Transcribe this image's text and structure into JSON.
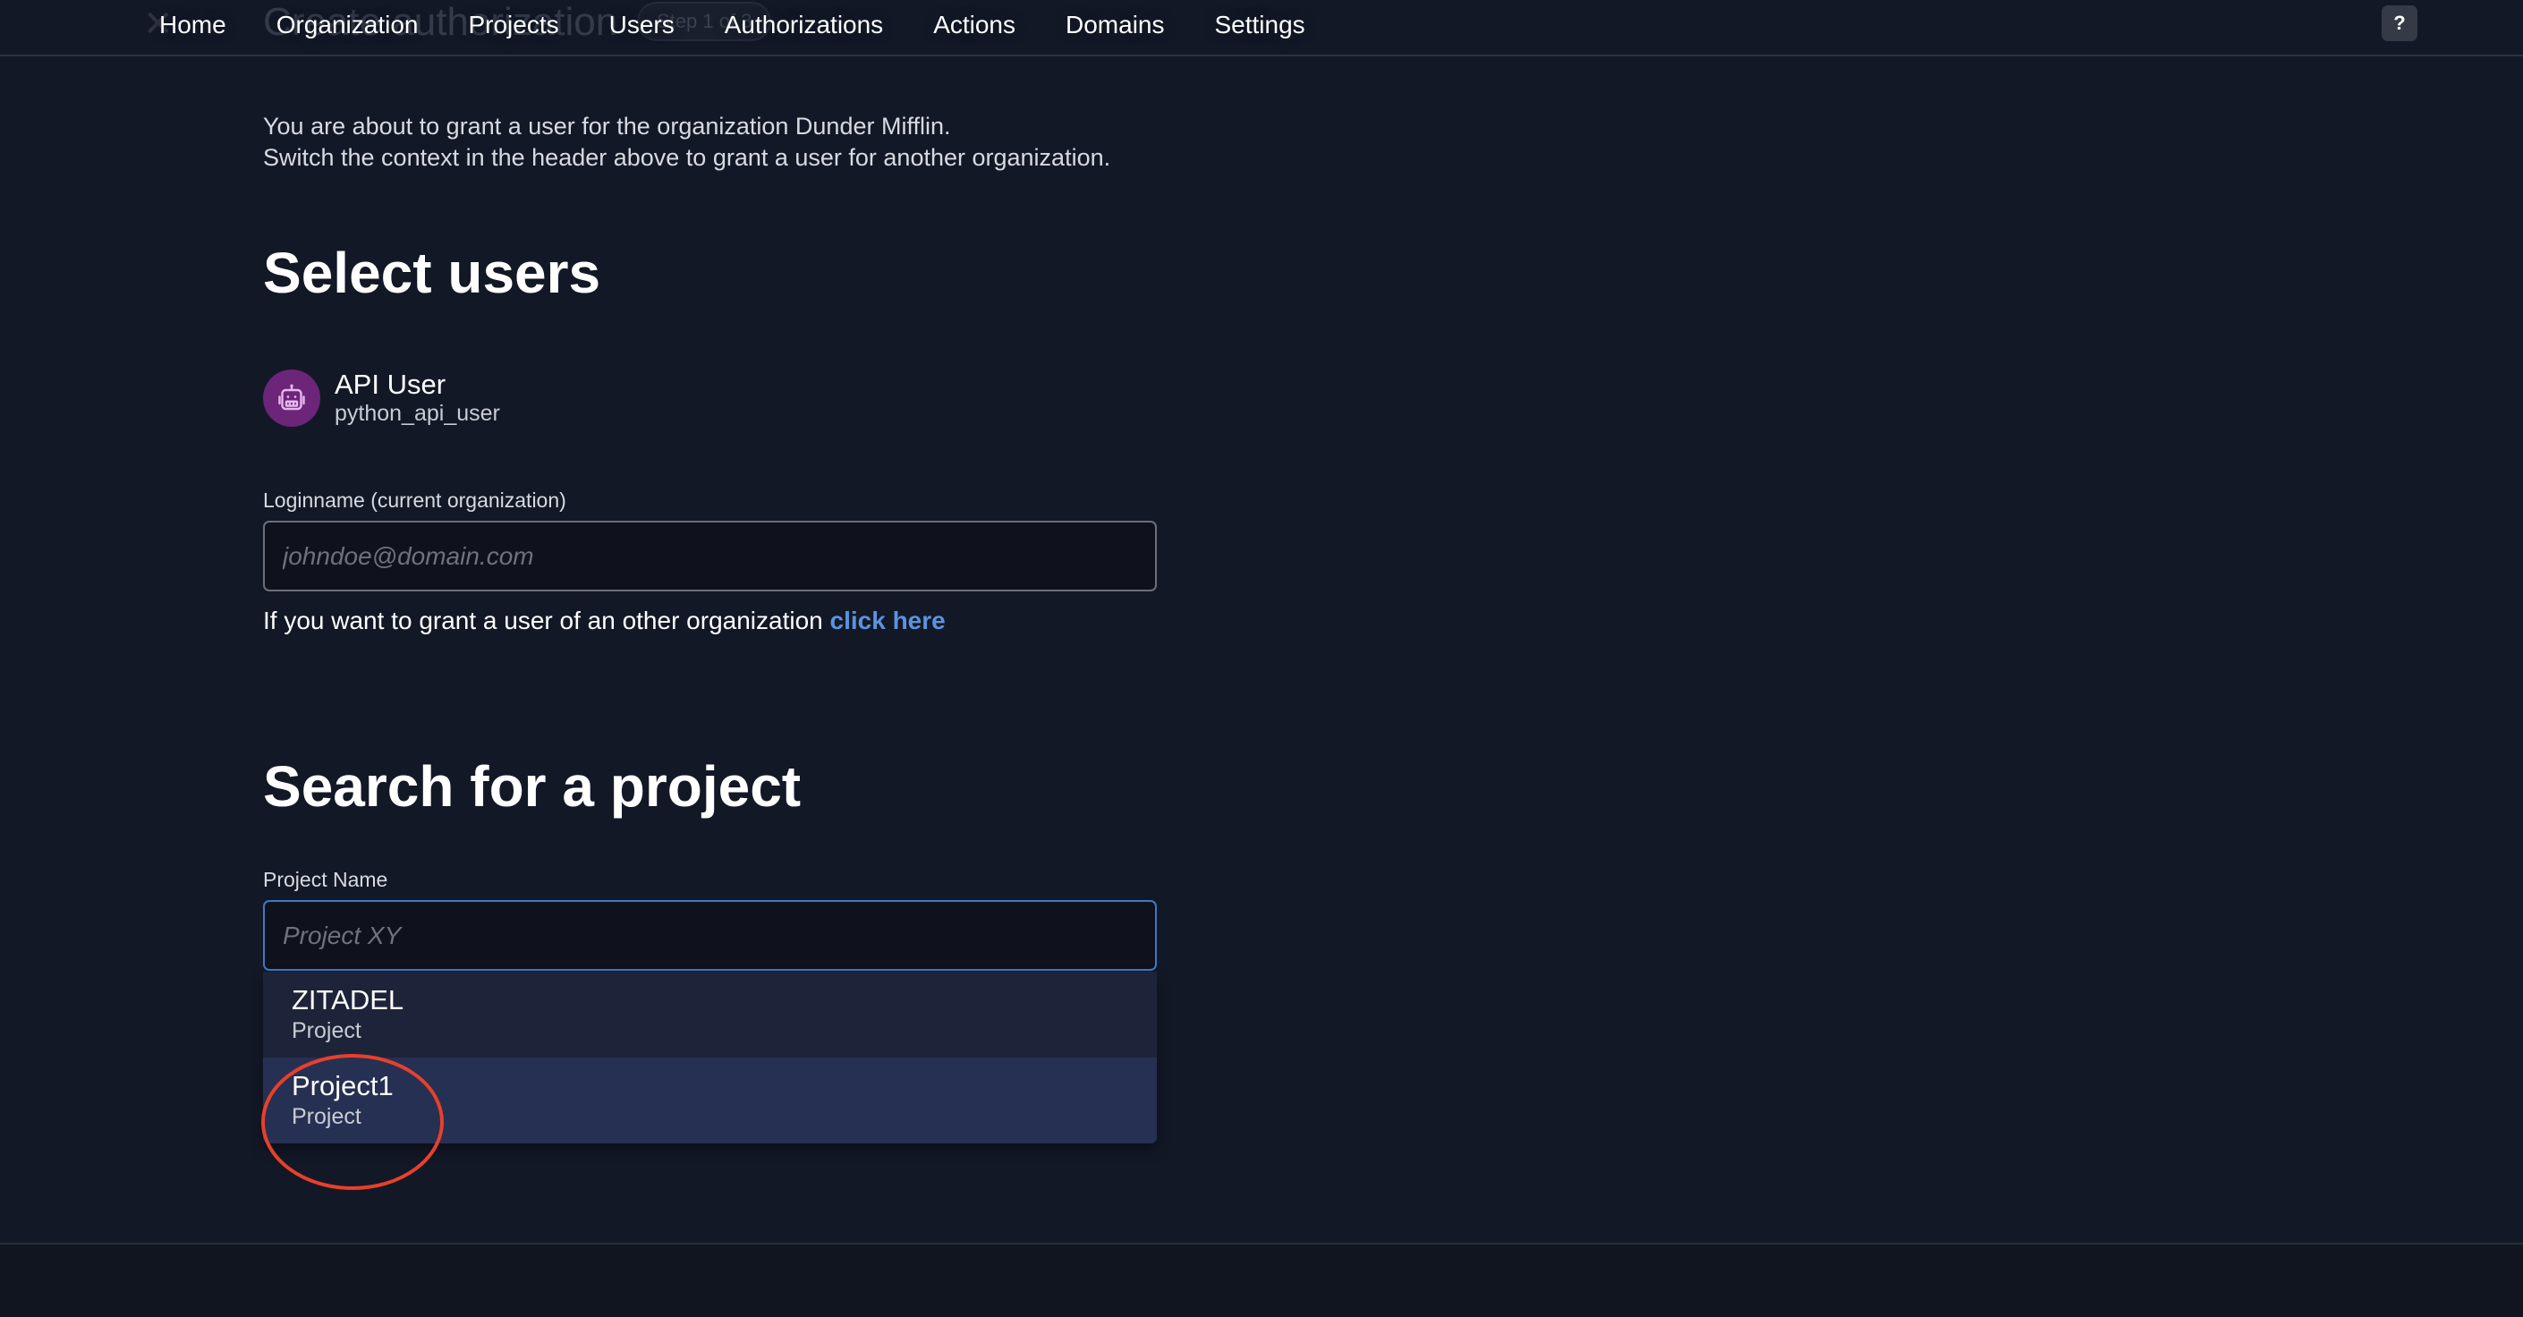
{
  "header": {
    "ghost_title": "Create authorization",
    "ghost_step": "Step 1 of 3",
    "nav": [
      {
        "label": "Home"
      },
      {
        "label": "Organization"
      },
      {
        "label": "Projects"
      },
      {
        "label": "Users"
      },
      {
        "label": "Authorizations"
      },
      {
        "label": "Actions"
      },
      {
        "label": "Domains"
      },
      {
        "label": "Settings"
      }
    ],
    "help_label": "?"
  },
  "intro": {
    "line1": "You are about to grant a user for the organization Dunder Mifflin.",
    "line2": "Switch the context in the header above to grant a user for another organization."
  },
  "select_users": {
    "heading": "Select users",
    "user": {
      "name": "API User",
      "login": "python_api_user",
      "avatar_icon": "robot-icon",
      "avatar_color": "#6c2579"
    },
    "loginname_label": "Loginname (current organization)",
    "loginname_value": "",
    "loginname_placeholder": "johndoe@domain.com",
    "other_org_text": "If you want to grant a user of an other organization",
    "other_org_link": "click here"
  },
  "search_project": {
    "heading": "Search for a project",
    "project_name_label": "Project Name",
    "project_name_value": "",
    "project_name_placeholder": "Project XY",
    "results": [
      {
        "name": "ZITADEL",
        "type": "Project"
      },
      {
        "name": "Project1",
        "type": "Project",
        "highlighted": true
      }
    ]
  },
  "colors": {
    "background": "#131827",
    "link": "#5b93dd",
    "focus_border": "#3f78c4",
    "annotation": "#e8402a"
  }
}
